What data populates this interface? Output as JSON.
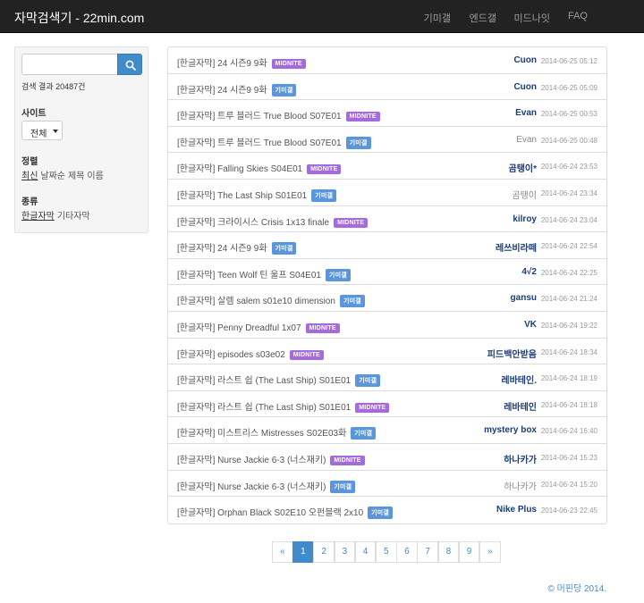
{
  "navbar": {
    "brand": "자막검색기 - 22min.com",
    "links": [
      "기미갤",
      "엔드갤",
      "미드나잇",
      "FAQ"
    ]
  },
  "sidebar": {
    "search": {
      "value": "",
      "placeholder": ""
    },
    "result_count": "검색 결과 20487건",
    "site": {
      "title": "사이트",
      "selected": "전체"
    },
    "sort": {
      "title": "정렬",
      "options": [
        "최신",
        "날짜순",
        "제목",
        "이름"
      ]
    },
    "type": {
      "title": "종류",
      "options": [
        "한글자막",
        "기타자막"
      ]
    }
  },
  "list": [
    {
      "title": "[한글자막] 24 시즌9 9화",
      "badge": "MIDNITE",
      "author": "Cuon",
      "date": "2014-06-25 05:12"
    },
    {
      "title": "[한글자막] 24 시즌9 9화",
      "badge": "기미갤",
      "author": "Cuon",
      "date": "2014-06-25 05:09"
    },
    {
      "title": "[한글자막] 트루 블러드 True Blood S07E01",
      "badge": "MIDNITE",
      "author": "Evan",
      "date": "2014-06-25 00:53"
    },
    {
      "title": "[한글자막] 트루 블러드 True Blood S07E01",
      "badge": "기미갤",
      "author": "Evan",
      "date": "2014-06-25 00:48"
    },
    {
      "title": "[한글자막] Falling Skies S04E01",
      "badge": "MIDNITE",
      "author": "곰탱이*",
      "date": "2014-06-24 23:53"
    },
    {
      "title": "[한글자막] The Last Ship S01E01",
      "badge": "기미갤",
      "author": "곰탱이",
      "date": "2014-06-24 23:34"
    },
    {
      "title": "[한글자막] 크라이시스 Crisis 1x13 finale",
      "badge": "MIDNITE",
      "author": "kilroy",
      "date": "2014-06-24 23:04"
    },
    {
      "title": "[한글자막] 24 시즌9 9화",
      "badge": "기미갤",
      "author": "레쓰비라떼",
      "date": "2014-06-24 22:54"
    },
    {
      "title": "[한글자막] Teen Wolf 틴 울프 S04E01",
      "badge": "기미갤",
      "author": "4√2",
      "date": "2014-06-24 22:25"
    },
    {
      "title": "[한글자막] 살렘 salem s01e10 dimension",
      "badge": "기미갤",
      "author": "gansu",
      "date": "2014-06-24 21:24"
    },
    {
      "title": "[한글자막] Penny Dreadful 1x07",
      "badge": "MIDNITE",
      "author": "VK",
      "date": "2014-06-24 19:22"
    },
    {
      "title": "[한글자막] episodes s03e02",
      "badge": "MIDNITE",
      "author": "피드백안받음",
      "date": "2014-06-24 18:34"
    },
    {
      "title": "[한글자막] 라스트 쉽 (The Last Ship) S01E01",
      "badge": "기미갤",
      "author": "레바테인.",
      "date": "2014-06-24 18:19"
    },
    {
      "title": "[한글자막] 라스트 쉽 (The Last Ship) S01E01",
      "badge": "MIDNITE",
      "author": "레바테인",
      "date": "2014-06-24 18:18"
    },
    {
      "title": "[한글자막] 미스트리스 Mistresses S02E03화",
      "badge": "기미갤",
      "author": "mystery box",
      "date": "2014-06-24 16:40"
    },
    {
      "title": "[한글자막] Nurse Jackie 6-3 (너스재키)",
      "badge": "MIDNITE",
      "author": "하나카가",
      "date": "2014-06-24 15:23"
    },
    {
      "title": "[한글자막] Nurse Jackie 6-3 (너스재키)",
      "badge": "기미갤",
      "author": "하나카가",
      "date": "2014-06-24 15:20"
    },
    {
      "title": "[한글자막] Orphan Black S02E10 오펀블랙 2x10",
      "badge": "기미갤",
      "author": "Nike Plus",
      "date": "2014-06-23 22:45"
    }
  ],
  "pagination": [
    "«",
    "1",
    "2",
    "3",
    "4",
    "5",
    "6",
    "7",
    "8",
    "9",
    "»"
  ],
  "footer": "© 머핀당 2014."
}
